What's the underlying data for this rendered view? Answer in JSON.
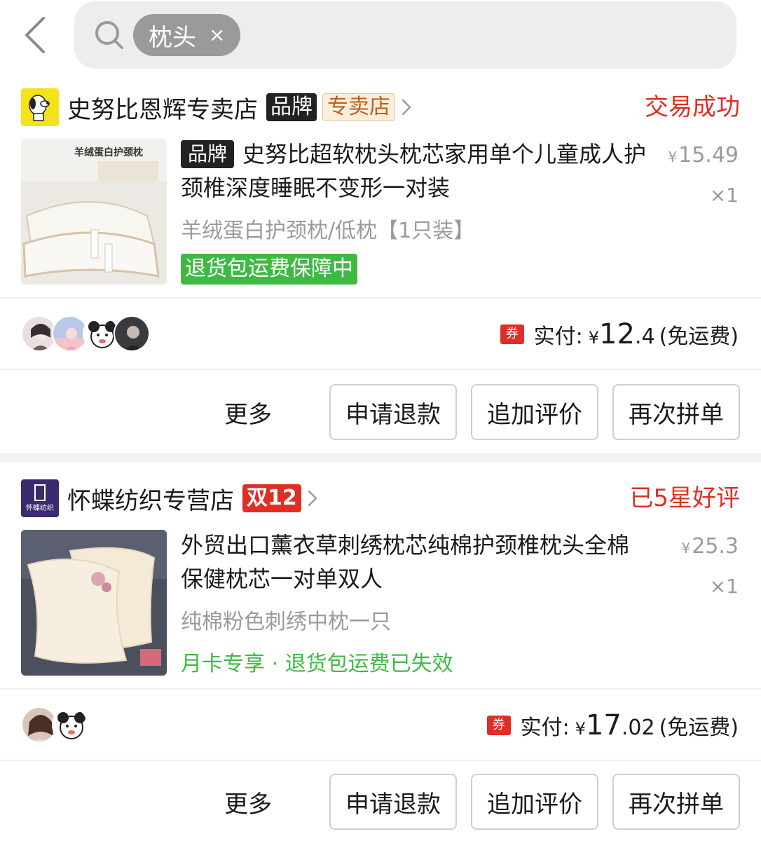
{
  "search": {
    "chip_text": "枕头",
    "chip_close": "×"
  },
  "orders": [
    {
      "store": {
        "name": "史努比恩辉专卖店",
        "tag_brand": "品牌",
        "tag_type": "专卖店"
      },
      "status": "交易成功",
      "product": {
        "title_tag": "品牌",
        "title": "史努比超软枕头枕芯家用单个儿童成人护颈椎深度睡眠不变形一对装",
        "image_caption": "羊绒蛋白护颈枕",
        "price_symbol": "¥",
        "price": "15.49",
        "qty": "×1",
        "sku": "羊绒蛋白护颈枕/低枕【1只装】",
        "badge": "退货包运费保障中"
      },
      "payment": {
        "coupon_icon": "券",
        "label": "实付:",
        "symbol": "¥",
        "int": "12",
        "dec": ".4",
        "note": "(免运费)"
      },
      "actions": {
        "more": "更多",
        "refund": "申请退款",
        "review": "追加评价",
        "reorder": "再次拼单"
      }
    },
    {
      "store": {
        "name": "怀蝶纺织专营店",
        "tag_promo": "双12",
        "logo_text": "怀蝶纺织"
      },
      "status": "已5星好评",
      "product": {
        "title": "外贸出口薰衣草刺绣枕芯纯棉护颈椎枕头全棉保健枕芯一对单双人",
        "price_symbol": "¥",
        "price": "25.3",
        "qty": "×1",
        "sku": "纯棉粉色刺绣中枕一只",
        "note": "月卡专享 · 退货包运费已失效"
      },
      "payment": {
        "coupon_icon": "券",
        "label": "实付:",
        "symbol": "¥",
        "int": "17",
        "dec": ".02",
        "note": "(免运费)"
      },
      "actions": {
        "more": "更多",
        "refund": "申请退款",
        "review": "追加评价",
        "reorder": "再次拼单"
      }
    }
  ],
  "colors": {
    "accent_red": "#e02e24",
    "green": "#3fb944",
    "muted": "#9a9a9a"
  }
}
